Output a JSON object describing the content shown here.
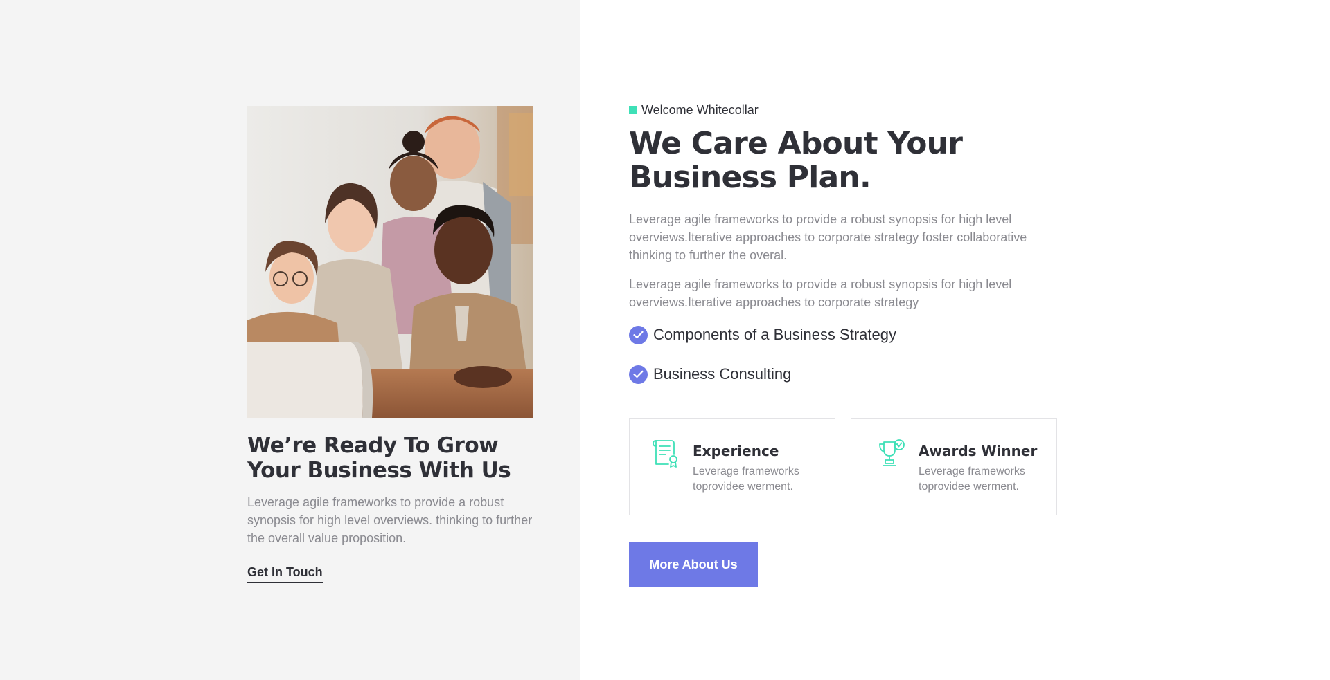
{
  "left": {
    "heading": "We’re Ready To Grow Your Business With Us",
    "text": "Leverage agile frameworks to provide a robust synopsis for high level overviews. thinking to further the overall value proposition.",
    "link_label": "Get In Touch"
  },
  "right": {
    "eyebrow": "Welcome Whitecollar",
    "heading": "We Care About Your Business Plan.",
    "paragraph_1": "Leverage agile frameworks to provide a robust synopsis for high level overviews.Iterative approaches to corporate strategy foster collaborative thinking to further the overal.",
    "paragraph_2": "Leverage agile frameworks to provide a robust synopsis for high level overviews.Iterative approaches to corporate strategy",
    "checklist": [
      "Components of a Business Strategy",
      "Business Consulting"
    ],
    "cards": [
      {
        "title": "Experience",
        "text": "Leverage frameworks toprovidee werment.",
        "icon": "certificate-icon"
      },
      {
        "title": "Awards Winner",
        "text": "Leverage frameworks toprovidee werment.",
        "icon": "trophy-icon"
      }
    ],
    "button_label": "More About Us"
  },
  "colors": {
    "accent": "#6e79e6",
    "teal": "#3ee0b7",
    "heading": "#2f3037",
    "body_text": "#8a8a90",
    "left_panel_bg": "#f4f4f4"
  }
}
